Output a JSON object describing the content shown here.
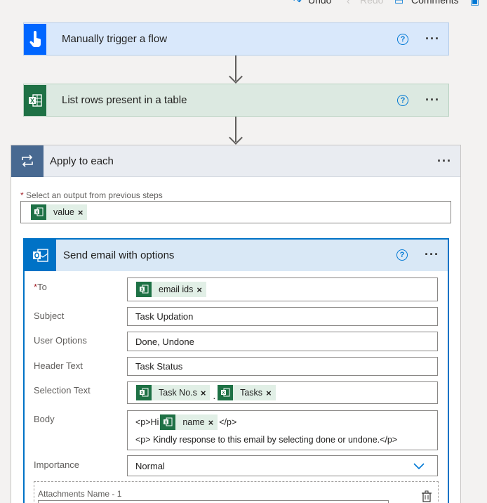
{
  "toolbar": {
    "undo_label": "Undo",
    "redo_label": "Redo",
    "comments_label": "Comments"
  },
  "steps": {
    "trigger": {
      "title": "Manually trigger a flow",
      "color": "#0066ff"
    },
    "list_rows": {
      "title": "List rows present in a table",
      "color": "#1e7145"
    },
    "apply_each": {
      "title": "Apply to each",
      "color": "#486991",
      "output_label": "Select an output from previous steps",
      "output_token": "value"
    },
    "send_email": {
      "title": "Send email with options",
      "color": "#0072c6",
      "fields": {
        "to": {
          "label": "To",
          "token": "email ids"
        },
        "subject": {
          "label": "Subject",
          "value": "Task Updation"
        },
        "user_options": {
          "label": "User Options",
          "value": "Done, Undone"
        },
        "header_text": {
          "label": "Header Text",
          "value": "Task Status"
        },
        "selection_text": {
          "label": "Selection Text",
          "token1": "Task No.s",
          "separator": ".",
          "token2": "Tasks"
        },
        "body": {
          "label": "Body",
          "line1_prefix": "<p>Hi",
          "line1_token": "name",
          "line1_suffix": "</p>",
          "line2": "<p> Kindly response to this email by selecting done or undone.</p>"
        },
        "importance": {
          "label": "Importance",
          "value": "Normal"
        },
        "attachments": {
          "label": "Attachments Name - 1"
        }
      }
    }
  },
  "colors": {
    "accent": "#0078d4",
    "token_bg": "#e1efe6",
    "excel_green": "#1e7145"
  }
}
